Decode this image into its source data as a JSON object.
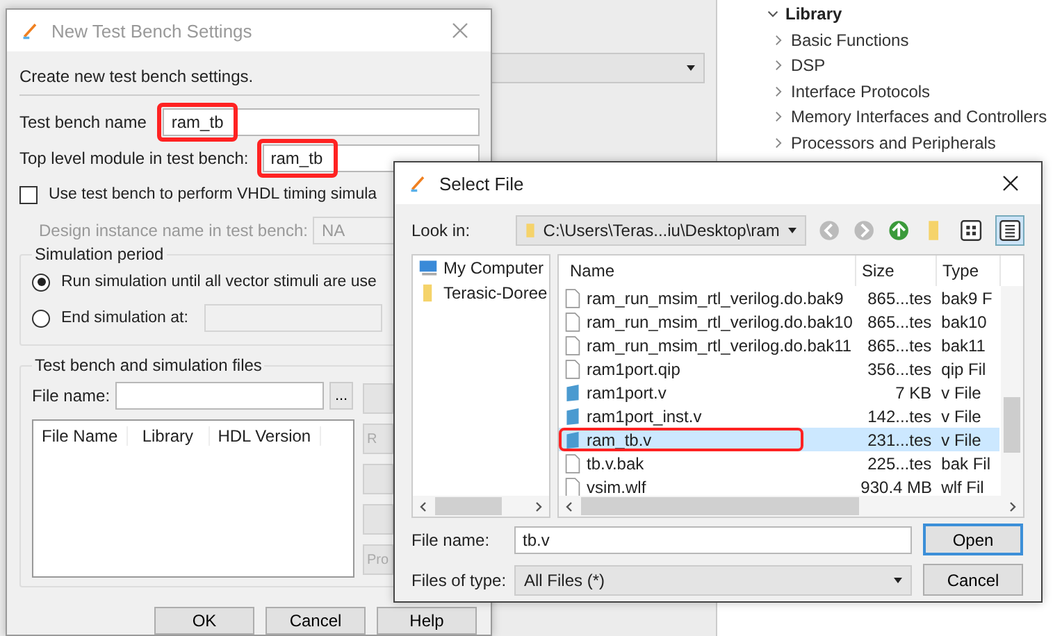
{
  "library_panel": {
    "label": "Library",
    "expanded": true,
    "children": [
      {
        "label": "Basic Functions",
        "expanded": false
      },
      {
        "label": "DSP",
        "expanded": false
      },
      {
        "label": "Interface Protocols",
        "expanded": false
      },
      {
        "label": "Memory Interfaces and Controllers",
        "expanded": false
      },
      {
        "label": "Processors and Peripherals",
        "expanded": false
      }
    ]
  },
  "test_bench_dialog": {
    "title": "New Test Bench Settings",
    "intro": "Create new test bench settings.",
    "name_label": "Test bench name",
    "name_value": "ram_tb",
    "name_highlighted": true,
    "top_label": "Top level module in test bench:",
    "top_value": "ram_tb",
    "top_highlighted": true,
    "vhdl_checkbox": {
      "label": "Use test bench to perform VHDL timing simula",
      "checked": false
    },
    "instance_label": "Design instance name in test bench:",
    "instance_value": "NA",
    "instance_disabled": true,
    "period_title": "Simulation period",
    "period_options": [
      {
        "label": "Run simulation until all vector stimuli are use",
        "selected": true
      },
      {
        "label": "End simulation at:",
        "selected": false
      }
    ],
    "files_title": "Test bench and simulation files",
    "file_name_label": "File name:",
    "browse_button": "...",
    "columns": [
      "File Name",
      "Library",
      "HDL Version"
    ],
    "side_buttons": [
      {
        "kind": "blank"
      },
      {
        "kind": "text",
        "label": "R"
      },
      {
        "kind": "blank"
      },
      {
        "kind": "blank"
      },
      {
        "kind": "text",
        "label": "Pro"
      }
    ],
    "buttons": [
      "OK",
      "Cancel",
      "Help"
    ]
  },
  "select_file_dialog": {
    "title": "Select File",
    "look_in_label": "Look in:",
    "look_in_value": "C:\\Users\\Teras...iu\\Desktop\\ram",
    "places": [
      {
        "label": "My Computer",
        "kind": "computer"
      },
      {
        "label": "Terasic-Doree",
        "kind": "folder"
      }
    ],
    "columns": [
      "Name",
      "Size",
      "Type"
    ],
    "files": [
      {
        "name": "ram_run_msim_rtl_verilog.do.bak9",
        "size": "865...tes",
        "type": "bak9 F",
        "kind": "doc",
        "selected": false,
        "highlighted": false
      },
      {
        "name": "ram_run_msim_rtl_verilog.do.bak10",
        "size": "865...tes",
        "type": "bak10",
        "kind": "doc",
        "selected": false,
        "highlighted": false
      },
      {
        "name": "ram_run_msim_rtl_verilog.do.bak11",
        "size": "865...tes",
        "type": "bak11",
        "kind": "doc",
        "selected": false,
        "highlighted": false
      },
      {
        "name": "ram1port.qip",
        "size": "356...tes",
        "type": "qip Fil",
        "kind": "doc",
        "selected": false,
        "highlighted": false
      },
      {
        "name": "ram1port.v",
        "size": "7 KB",
        "type": "v File",
        "kind": "verilog",
        "selected": false,
        "highlighted": false
      },
      {
        "name": "ram1port_inst.v",
        "size": "142...tes",
        "type": "v File",
        "kind": "verilog",
        "selected": false,
        "highlighted": false
      },
      {
        "name": "ram_tb.v",
        "size": "231...tes",
        "type": "v File",
        "kind": "verilog",
        "selected": true,
        "highlighted": true
      },
      {
        "name": "tb.v.bak",
        "size": "225...tes",
        "type": "bak Fil",
        "kind": "doc",
        "selected": false,
        "highlighted": false
      },
      {
        "name": "vsim.wlf",
        "size": "930.4 MB",
        "type": "wlf Fil",
        "kind": "doc",
        "selected": false,
        "highlighted": false
      }
    ],
    "file_name_label": "File name:",
    "file_name_value": "tb.v",
    "file_type_label": "Files of type:",
    "file_type_value": "All Files (*)",
    "buttons": [
      "Open",
      "Cancel"
    ]
  }
}
